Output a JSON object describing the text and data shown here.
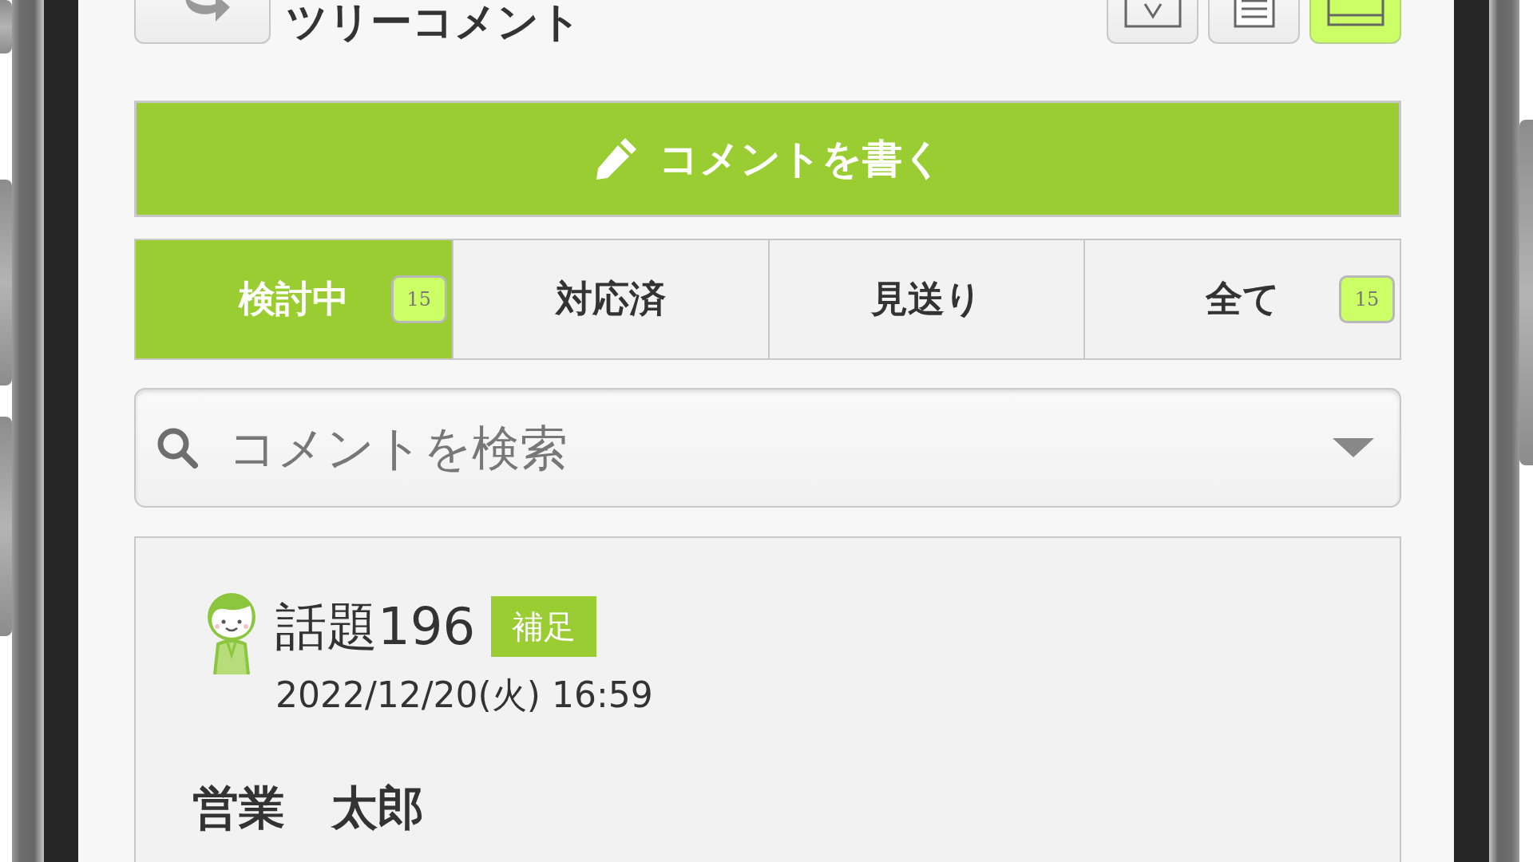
{
  "header": {
    "title": "ツリーコメント",
    "view_buttons": [
      {
        "selected": false
      },
      {
        "selected": false
      },
      {
        "selected": true
      }
    ]
  },
  "write_button": {
    "label": "コメントを書く"
  },
  "tabs": [
    {
      "label": "検討中",
      "badge": "15",
      "selected": true
    },
    {
      "label": "対応済",
      "selected": false
    },
    {
      "label": "見送り",
      "selected": false
    },
    {
      "label": "全て",
      "badge": "15",
      "selected": false
    }
  ],
  "search": {
    "placeholder": "コメントを検索"
  },
  "comments": [
    {
      "title": "話題196",
      "tag": "補足",
      "date": "2022/12/20(火) 16:59",
      "author": "営業　太郎"
    }
  ]
}
